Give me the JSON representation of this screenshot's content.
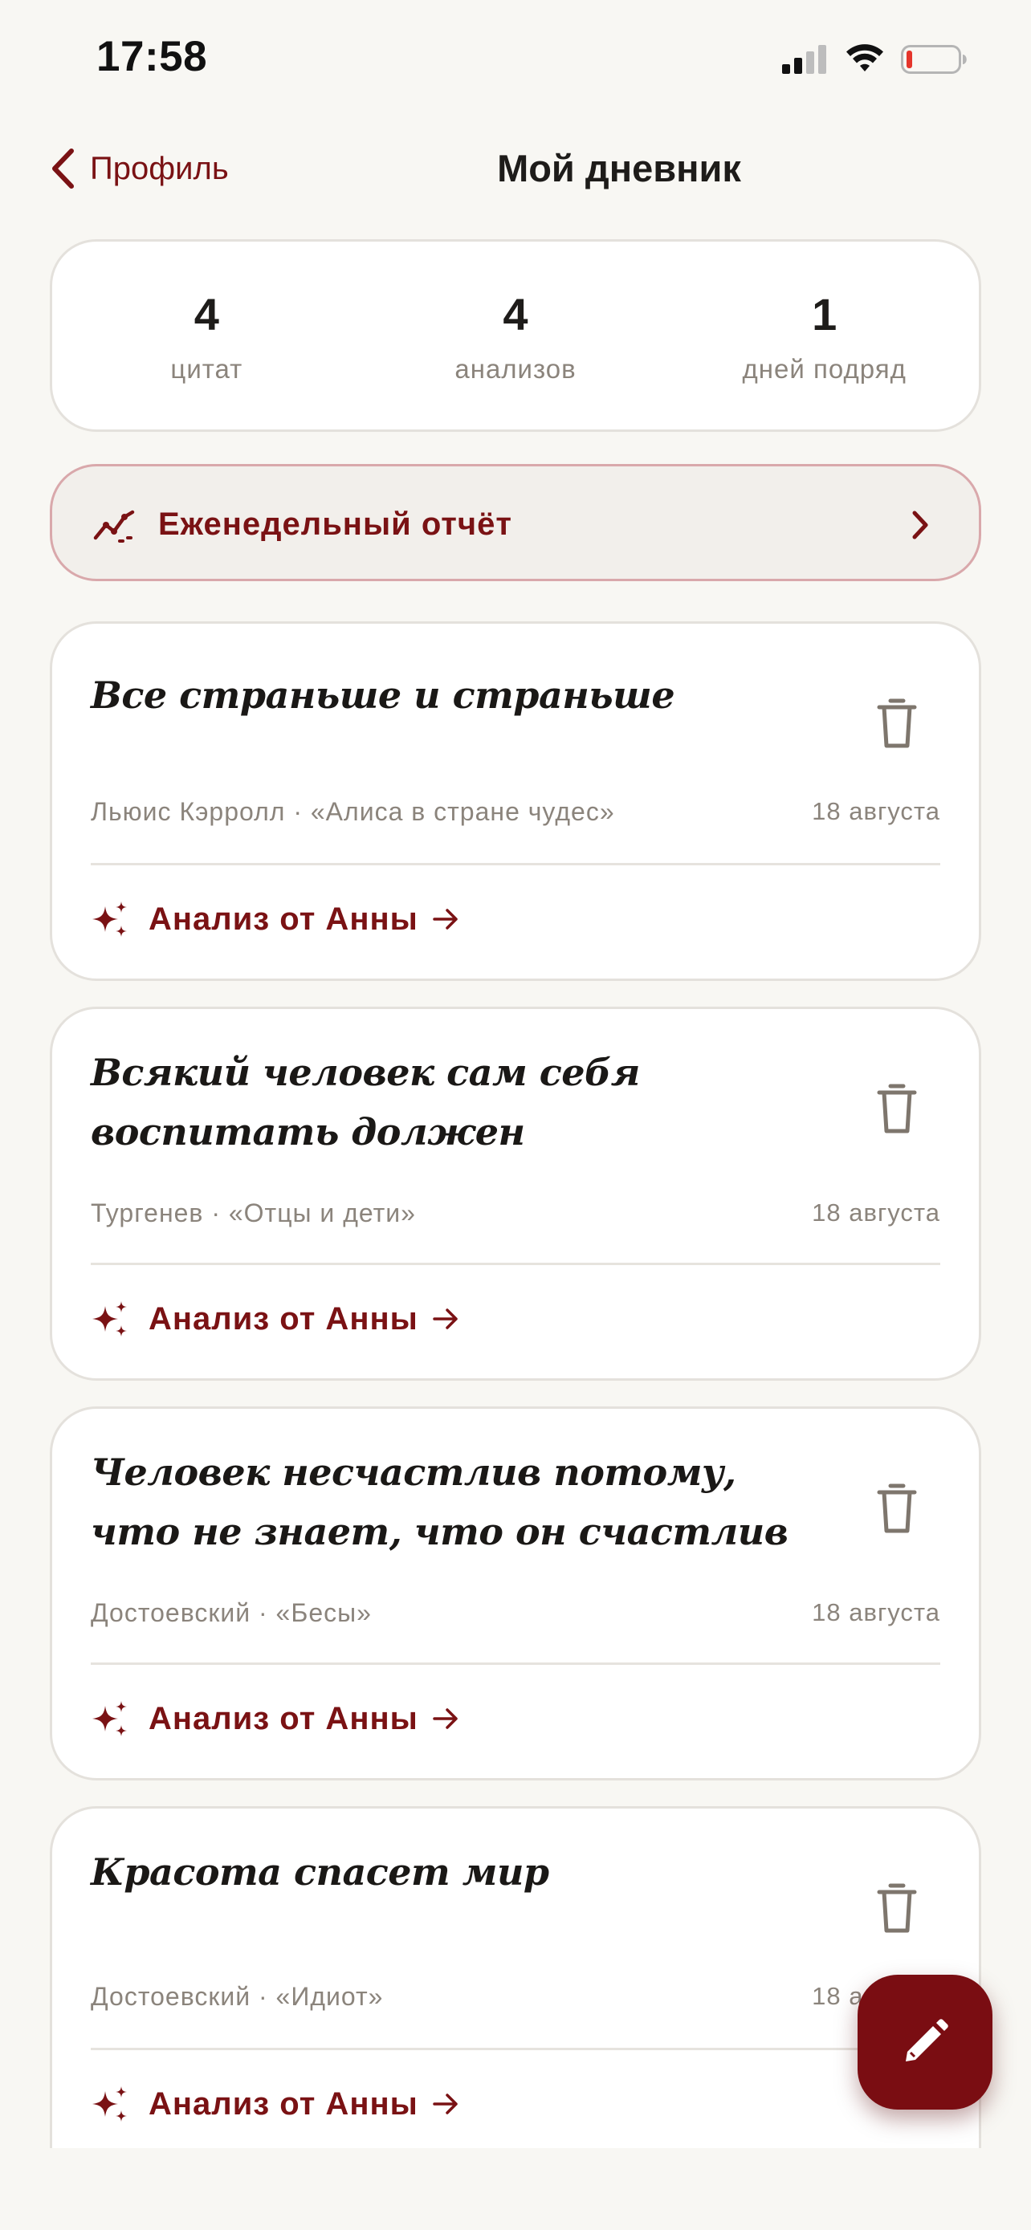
{
  "status_bar": {
    "time": "17:58"
  },
  "nav": {
    "back_label": "Профиль",
    "title": "Мой дневник"
  },
  "stats": [
    {
      "value": "4",
      "label": "цитат"
    },
    {
      "value": "4",
      "label": "анализов"
    },
    {
      "value": "1",
      "label": "дней подряд"
    }
  ],
  "weekly_report": {
    "label": "Еженедельный отчёт"
  },
  "quotes": [
    {
      "text": "Все страньше и страньше",
      "source": "Льюис Кэрролл · «Алиса в стране чудес»",
      "date": "18 августа",
      "analysis_label": "Анализ от Анны"
    },
    {
      "text": "Всякий человек сам себя воспитать должен",
      "source": "Тургенев · «Отцы и дети»",
      "date": "18 августа",
      "analysis_label": "Анализ от Анны"
    },
    {
      "text": "Человек несчастлив потому, что не знает, что он счастлив",
      "source": "Достоевский · «Бесы»",
      "date": "18 августа",
      "analysis_label": "Анализ от Анны"
    },
    {
      "text": "Красота спасет мир",
      "source": "Достоевский · «Идиот»",
      "date": "18 августа",
      "analysis_label": "Анализ от Анны"
    }
  ],
  "colors": {
    "accent": "#7a1214",
    "fab": "#7a0d12",
    "background": "#f8f7f3",
    "muted_text": "#8b847c"
  }
}
